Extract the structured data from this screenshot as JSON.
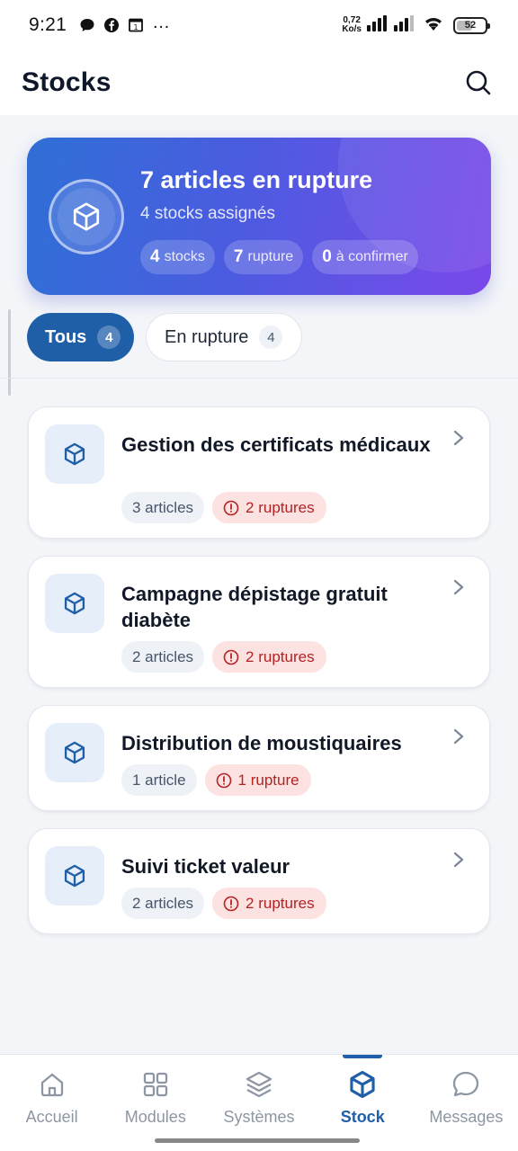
{
  "status_bar": {
    "time": "9:21",
    "speed_value": "0,72",
    "speed_unit": "Ko/s",
    "battery": "52"
  },
  "header": {
    "title": "Stocks"
  },
  "summary": {
    "title": "7 articles en rupture",
    "subtitle": "4 stocks assignés",
    "chips": [
      {
        "value": "4",
        "label": "stocks"
      },
      {
        "value": "7",
        "label": "rupture"
      },
      {
        "value": "0",
        "label": "à confirmer"
      }
    ]
  },
  "filters": [
    {
      "label": "Tous",
      "count": "4",
      "active": true
    },
    {
      "label": "En rupture",
      "count": "4",
      "active": false
    }
  ],
  "stocks": [
    {
      "title": "Gestion des certificats médicaux",
      "articles": "3 articles",
      "ruptures": "2 ruptures"
    },
    {
      "title": "Campagne dépistage gratuit diabète",
      "articles": "2 articles",
      "ruptures": "2 ruptures"
    },
    {
      "title": "Distribution de moustiquaires",
      "articles": "1 article",
      "ruptures": "1 rupture"
    },
    {
      "title": "Suivi ticket valeur",
      "articles": "2 articles",
      "ruptures": "2 ruptures"
    }
  ],
  "bottom_nav": [
    {
      "label": "Accueil",
      "icon": "home-icon",
      "active": false
    },
    {
      "label": "Modules",
      "icon": "grid-icon",
      "active": false
    },
    {
      "label": "Systèmes",
      "icon": "layers-icon",
      "active": false
    },
    {
      "label": "Stock",
      "icon": "box-icon",
      "active": true
    },
    {
      "label": "Messages",
      "icon": "chat-bubble-icon",
      "active": false
    }
  ],
  "colors": {
    "primary": "#1f5fa8",
    "hero_gradient_start": "#2f6fd6",
    "hero_gradient_end": "#7a48ea",
    "rupture_text": "#b42323",
    "rupture_bg": "#fde2e2"
  }
}
